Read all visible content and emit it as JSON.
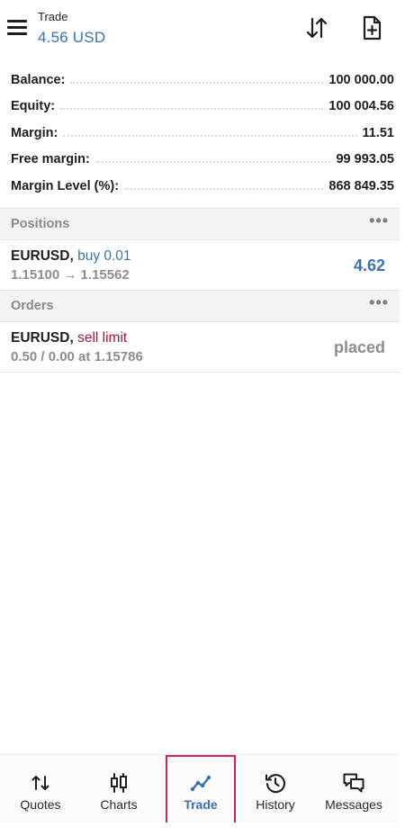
{
  "header": {
    "label": "Trade",
    "value": "4.56 USD",
    "icons": {
      "menu": "hamburger-menu-icon",
      "sort": "sort-arrows-icon",
      "new_order": "new-document-icon"
    }
  },
  "summary": {
    "rows": [
      {
        "key": "Balance:",
        "value": "100 000.00"
      },
      {
        "key": "Equity:",
        "value": "100 004.56"
      },
      {
        "key": "Margin:",
        "value": "11.51"
      },
      {
        "key": "Free margin:",
        "value": "99 993.05"
      },
      {
        "key": "Margin Level (%):",
        "value": "868 849.35"
      }
    ]
  },
  "positions": {
    "title": "Positions",
    "more": "•••",
    "items": [
      {
        "symbol": "EURUSD,",
        "action": "buy 0.01",
        "detail": "1.15100 → 1.15562",
        "right": "4.62"
      }
    ]
  },
  "orders": {
    "title": "Orders",
    "more": "•••",
    "items": [
      {
        "symbol": "EURUSD,",
        "action": "sell limit",
        "detail": "0.50 / 0.00 at 1.15786",
        "right": "placed"
      }
    ]
  },
  "nav": {
    "items": [
      {
        "label": "Quotes",
        "icon": "quotes-icon"
      },
      {
        "label": "Charts",
        "icon": "candlestick-chart-icon"
      },
      {
        "label": "Trade",
        "icon": "trade-line-icon",
        "active": true
      },
      {
        "label": "History",
        "icon": "history-clock-icon"
      },
      {
        "label": "Messages",
        "icon": "messages-icon"
      }
    ]
  },
  "colors": {
    "accent": "#3b71b2",
    "sell": "#a6162d",
    "highlight": "#d1235a"
  }
}
